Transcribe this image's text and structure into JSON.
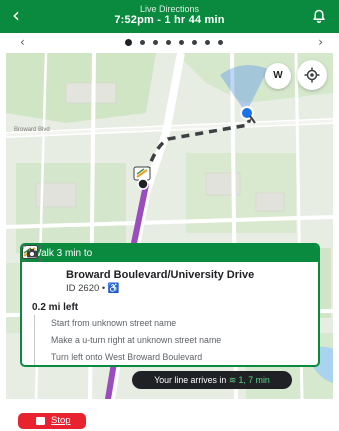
{
  "header": {
    "title": "Live Directions",
    "subtitle": "7:52pm - 1 hr 44 min",
    "back_icon": "back-arrow-icon",
    "alert_icon": "bell-icon"
  },
  "pager": {
    "prev_icon": "chevron-left-icon",
    "next_icon": "chevron-right-icon",
    "page_count": 8,
    "active_index": 0
  },
  "map": {
    "compass_label": "W",
    "road_label": "Broward Blvd",
    "locate_icon": "my-location-icon"
  },
  "card": {
    "header": "Walk 3 min to",
    "stop_name": "Broward Boulevard/University Drive",
    "stop_id": "ID 2620 • ♿",
    "distance": "0.2 mi left",
    "steps": [
      "Start from unknown street name",
      "Make a u-turn right at unknown street name",
      "Turn left onto West Broward Boulevard"
    ]
  },
  "arrival": {
    "prefix": "Your line arrives in",
    "times": "1, 7 min"
  },
  "stop_button": {
    "label": "Stop"
  },
  "colors": {
    "brand_green": "#0a8a3e",
    "route_purple": "#9b4dbd",
    "stop_red": "#e8232f"
  }
}
